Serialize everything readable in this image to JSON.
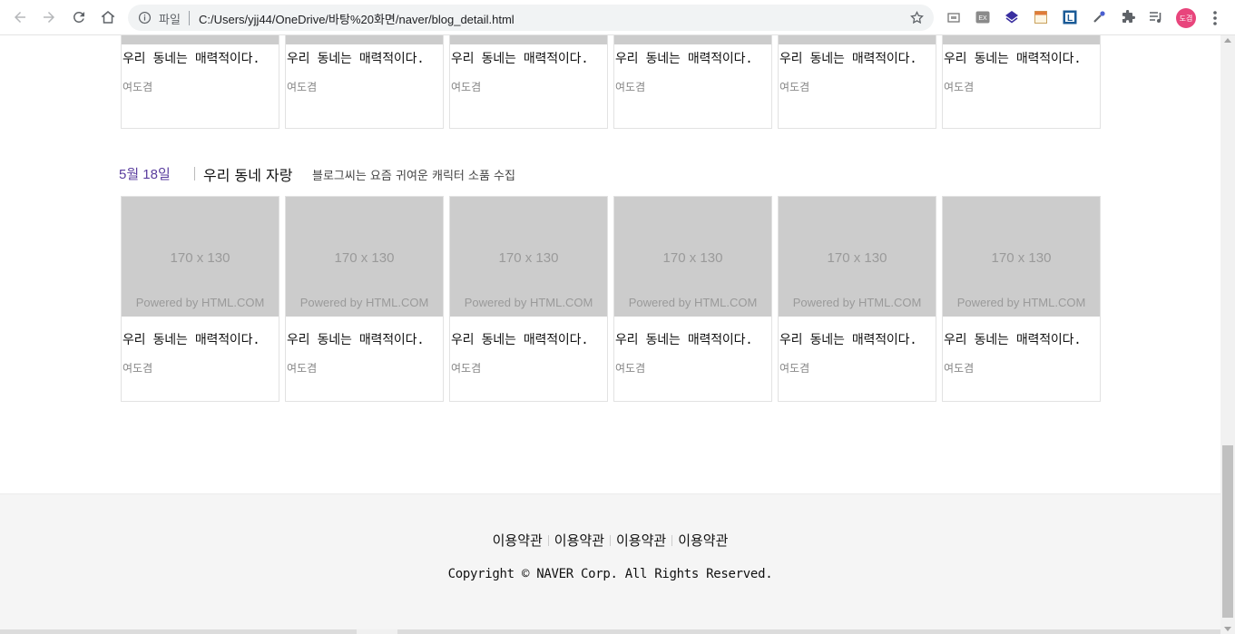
{
  "browser": {
    "scheme_label": "파일",
    "url": "C:/Users/yjj44/OneDrive/바탕%20화면/naver/blog_detail.html",
    "extensions": [
      "screenshot-extension-icon",
      "ex-extension-icon",
      "layers-extension-icon",
      "note-extension-icon",
      "l-extension-icon",
      "eyedropper-extension-icon",
      "puzzle-extensions-icon",
      "playlist-icon"
    ],
    "ext_labels": {
      "ex": "EX",
      "l": "L"
    },
    "profile_label": "도겸"
  },
  "row1": {
    "cards": [
      {
        "title": "우리 동네는 매력적이다.",
        "author": "여도겸"
      },
      {
        "title": "우리 동네는 매력적이다.",
        "author": "여도겸"
      },
      {
        "title": "우리 동네는 매력적이다.",
        "author": "여도겸"
      },
      {
        "title": "우리 동네는 매력적이다.",
        "author": "여도겸"
      },
      {
        "title": "우리 동네는 매력적이다.",
        "author": "여도겸"
      },
      {
        "title": "우리 동네는 매력적이다.",
        "author": "여도겸"
      }
    ]
  },
  "section2": {
    "date": "5월 18일",
    "title": "우리 동네 자랑",
    "description": "블로그씨는 요즘 귀여운 캐릭터 소품 수집"
  },
  "row2": {
    "cards": [
      {
        "thumb_size": "170 x 130",
        "thumb_powered": "Powered by HTML.COM",
        "title": "우리 동네는 매력적이다.",
        "author": "여도겸"
      },
      {
        "thumb_size": "170 x 130",
        "thumb_powered": "Powered by HTML.COM",
        "title": "우리 동네는 매력적이다.",
        "author": "여도겸"
      },
      {
        "thumb_size": "170 x 130",
        "thumb_powered": "Powered by HTML.COM",
        "title": "우리 동네는 매력적이다.",
        "author": "여도겸"
      },
      {
        "thumb_size": "170 x 130",
        "thumb_powered": "Powered by HTML.COM",
        "title": "우리 동네는 매력적이다.",
        "author": "여도겸"
      },
      {
        "thumb_size": "170 x 130",
        "thumb_powered": "Powered by HTML.COM",
        "title": "우리 동네는 매력적이다.",
        "author": "여도겸"
      },
      {
        "thumb_size": "170 x 130",
        "thumb_powered": "Powered by HTML.COM",
        "title": "우리 동네는 매력적이다.",
        "author": "여도겸"
      }
    ]
  },
  "footer": {
    "links": [
      "이용약관",
      "이용약관",
      "이용약관",
      "이용약관"
    ],
    "copyright": "Copyright © NAVER Corp. All Rights Reserved."
  },
  "colors": {
    "date_accent": "#5a3d9e",
    "thumb_bg": "#cccccc",
    "footer_bg": "#f5f5f5",
    "profile_bg": "#e8457c"
  }
}
